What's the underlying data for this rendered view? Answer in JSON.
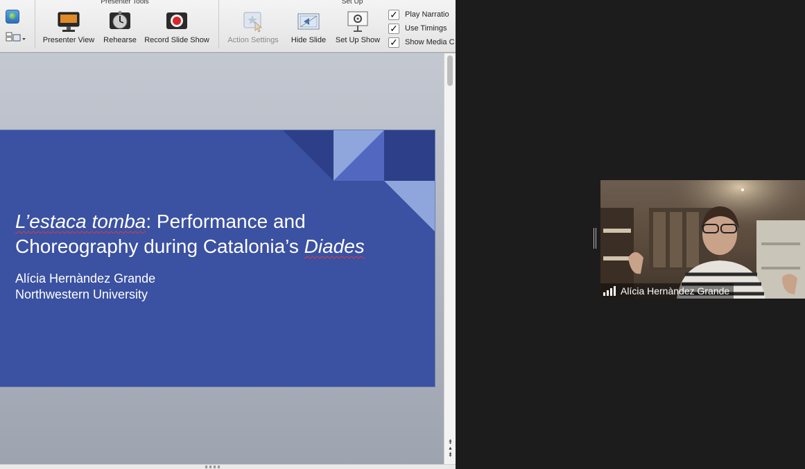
{
  "ribbon": {
    "groups": {
      "presenter_tools": "Presenter Tools",
      "set_up": "Set Up"
    },
    "buttons": {
      "presenter_view": "Presenter View",
      "rehearse": "Rehearse",
      "record_slide_show": "Record Slide Show",
      "action_settings": "Action Settings",
      "hide_slide": "Hide Slide",
      "set_up_show": "Set Up Show"
    },
    "checkboxes": {
      "play_narrations": {
        "label": "Play Narratio",
        "checked": true
      },
      "use_timings": {
        "label": "Use Timings",
        "checked": true
      },
      "show_media": {
        "label": "Show Media C",
        "checked": true
      }
    },
    "check_glyph": "✓"
  },
  "slide": {
    "title_part1_italic": "L’estaca tomba",
    "title_part2": ": Performance and",
    "title_line2": "Choreography during Catalonia’s ",
    "title_line2_italic": "Diades",
    "author": "Alícia Hernàndez Grande",
    "affiliation": "Northwestern University",
    "colors": {
      "background": "#3b51a2",
      "dark_triangle": "#2c3f88",
      "light_triangle": "#8fa6dc",
      "mid_triangle": "#5268c0"
    }
  },
  "scroll": {
    "up_glyph": "▲",
    "pg_up_glyph": "⇞",
    "pg_down_glyph": "⇟"
  },
  "video": {
    "participant_name": "Alícia Hernàndez Grande"
  }
}
